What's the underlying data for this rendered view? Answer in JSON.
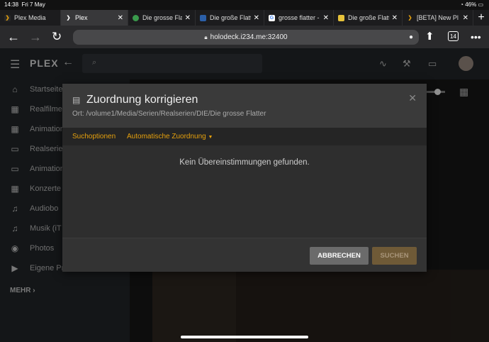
{
  "status": {
    "time": "14:38",
    "date": "Fri 7 May",
    "battery": "46%"
  },
  "tabs": [
    {
      "label": "Plex Media",
      "icon": "plex-icon",
      "active": false
    },
    {
      "label": "Plex",
      "icon": "plex-icon",
      "active": true
    },
    {
      "label": "Die grosse Flatt",
      "icon": "green-circle-icon",
      "active": false
    },
    {
      "label": "Die große Flatt",
      "icon": "blue-site-icon",
      "active": false
    },
    {
      "label": "grosse flatter -",
      "icon": "google-icon",
      "active": false
    },
    {
      "label": "Die große Flatt",
      "icon": "yellow-site-icon",
      "active": false
    },
    {
      "label": "[BETA] New Pl",
      "icon": "plex-icon",
      "active": false
    }
  ],
  "browser": {
    "url": "holodeck.i234.me:32400",
    "tab_count": "14"
  },
  "plex": {
    "logo": "PLEX"
  },
  "sidebar": {
    "items": [
      {
        "label": "Startseite",
        "icon": "home-icon"
      },
      {
        "label": "Realfilme",
        "icon": "film-icon"
      },
      {
        "label": "Animation",
        "icon": "film-icon"
      },
      {
        "label": "Realserien",
        "icon": "tv-icon"
      },
      {
        "label": "Animation",
        "icon": "tv-icon"
      },
      {
        "label": "Konzerte",
        "icon": "film-icon"
      },
      {
        "label": "Audiobo",
        "icon": "music-icon"
      },
      {
        "label": "Musik (iT",
        "icon": "music-icon"
      },
      {
        "label": "Photos",
        "icon": "camera-icon"
      },
      {
        "label": "Eigene Pr",
        "icon": "video-icon"
      }
    ],
    "more_label": "MEHR"
  },
  "modal": {
    "title": "Zuordnung korrigieren",
    "path": "Ort: /volume1/Media/Serien/Realserien/DIE/Die grosse Flatter",
    "tab_search_options": "Suchoptionen",
    "tab_auto_match": "Automatische Zuordnung",
    "no_results": "Kein Übereinstimmungen gefunden.",
    "cancel_label": "ABBRECHEN",
    "search_label": "SUCHEN"
  },
  "colors": {
    "accent": "#e5a00d",
    "modal_bg": "#2e2e2e",
    "sidebar_bg": "#1f2326"
  }
}
